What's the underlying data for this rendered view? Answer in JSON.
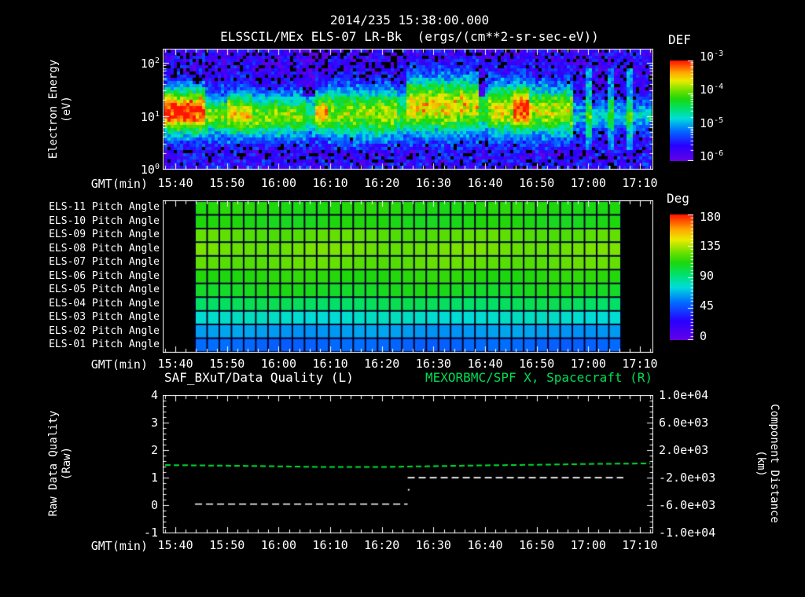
{
  "title": {
    "line1": "2014/235 15:38:00.000",
    "line2": "ELSSCIL/MEx ELS-07 LR-Bk  (ergs/(cm**2-sr-sec-eV))"
  },
  "time_axis": {
    "label": "GMT(min)",
    "start": "15:38",
    "ticks": [
      "15:40",
      "15:50",
      "16:00",
      "16:10",
      "16:20",
      "16:30",
      "16:40",
      "16:50",
      "17:00",
      "17:10"
    ]
  },
  "energy_panel": {
    "ylabel_line1": "Electron Energy",
    "ylabel_line2": "(eV)",
    "ytick_exponents": [
      "2",
      "1",
      "0"
    ],
    "colorbar": {
      "title": "DEF",
      "tick_exponents": [
        "-3",
        "-4",
        "-5",
        "-6"
      ]
    }
  },
  "pitch_panel": {
    "row_labels": [
      "ELS-11 Pitch Angle",
      "ELS-10 Pitch Angle",
      "ELS-09 Pitch Angle",
      "ELS-08 Pitch Angle",
      "ELS-07 Pitch Angle",
      "ELS-06 Pitch Angle",
      "ELS-05 Pitch Angle",
      "ELS-04 Pitch Angle",
      "ELS-03 Pitch Angle",
      "ELS-02 Pitch Angle",
      "ELS-01 Pitch Angle"
    ],
    "colorbar": {
      "title": "Deg",
      "ticks": [
        "180",
        "135",
        "90",
        "45",
        "0"
      ]
    }
  },
  "line_panel": {
    "title_left": "SAF_BXuT/Data Quality (L)",
    "title_right": "MEXORBMC/SPF X, Spacecraft (R)",
    "ylabel_left_line1": "Raw Data Quality",
    "ylabel_left_line2": "(Raw)",
    "ylabel_right_line1": "Component Distance",
    "ylabel_right_line2": "(km)",
    "yticks_left": [
      "4",
      "3",
      "2",
      "1",
      "0",
      "-1"
    ],
    "yticks_right": [
      "1.0e+04",
      "6.0e+03",
      "2.0e+03",
      "-2.0e+03",
      "-6.0e+03",
      "-1.0e+04"
    ]
  },
  "colors": {
    "background": "#000000",
    "text": "#ffffff",
    "title_green": "#00dd55",
    "line_green": "#00e030",
    "line_white": "#ffffff",
    "grid_dark": "#000022"
  },
  "chart_data": [
    {
      "type": "heatmap",
      "name": "electron_energy_flux_spectrogram",
      "x_label": "GMT(min)",
      "x_ticks": [
        "15:40",
        "15:50",
        "16:00",
        "16:10",
        "16:20",
        "16:30",
        "16:40",
        "16:50",
        "17:00",
        "17:10"
      ],
      "time_start": "15:38",
      "time_end": "17:12",
      "y_label": "Electron Energy (eV)",
      "y_scale": "log",
      "y_ticks_eV": [
        1,
        10,
        100
      ],
      "value_label": "DEF (ergs/(cm**2-sr-sec-eV))",
      "value_ticks": [
        0.001,
        0.0001,
        1e-05,
        1e-06
      ],
      "features": {
        "description": "Noisy rainbow spectrogram: main green/yellow flux band near 5-40 eV all interval; bright yellow/red enhancement 15:38-15:46; yellow blob ~16:07; broad bright band 16:25-16:57 with intense yellow column ~16:45-16:48; band ends ~16:58, after which only faint blue/cyan vertical streaks; blue/purple noise with black dropouts at lowest and highest energies",
        "segments": [
          {
            "t0_min": 0,
            "t1_min": 8,
            "intensity": 0.92,
            "center_log10_eV": 1.08,
            "width_log10": 0.42
          },
          {
            "t0_min": 8,
            "t1_min": 12,
            "intensity": 0.6,
            "center_log10_eV": 1.0,
            "width_log10": 0.38
          },
          {
            "t0_min": 12,
            "t1_min": 17,
            "intensity": 0.72,
            "center_log10_eV": 1.02,
            "width_log10": 0.4
          },
          {
            "t0_min": 17,
            "t1_min": 27,
            "intensity": 0.6,
            "center_log10_eV": 1.0,
            "width_log10": 0.4
          },
          {
            "t0_min": 27,
            "t1_min": 29,
            "intensity": 0.46,
            "center_log10_eV": 1.0,
            "width_log10": 0.36
          },
          {
            "t0_min": 29,
            "t1_min": 31.5,
            "intensity": 0.78,
            "center_log10_eV": 1.05,
            "width_log10": 0.38
          },
          {
            "t0_min": 31.5,
            "t1_min": 45,
            "intensity": 0.62,
            "center_log10_eV": 1.05,
            "width_log10": 0.46
          },
          {
            "t0_min": 45,
            "t1_min": 47,
            "intensity": 0.52,
            "center_log10_eV": 1.02,
            "width_log10": 0.42
          },
          {
            "t0_min": 47,
            "t1_min": 61,
            "intensity": 0.72,
            "center_log10_eV": 1.18,
            "width_log10": 0.52
          },
          {
            "t0_min": 61,
            "t1_min": 62.5,
            "intensity": 0.5,
            "center_log10_eV": 1.1,
            "width_log10": 0.45
          },
          {
            "t0_min": 62.5,
            "t1_min": 67.5,
            "intensity": 0.68,
            "center_log10_eV": 1.12,
            "width_log10": 0.48
          },
          {
            "t0_min": 67.5,
            "t1_min": 70.5,
            "intensity": 0.9,
            "center_log10_eV": 1.12,
            "width_log10": 0.46
          },
          {
            "t0_min": 70.5,
            "t1_min": 79,
            "intensity": 0.66,
            "center_log10_eV": 1.08,
            "width_log10": 0.46
          },
          {
            "t0_min": 79,
            "t1_min": 95,
            "intensity": 0.3,
            "center_log10_eV": 1.0,
            "width_log10": 0.3
          }
        ],
        "cyan_streaks_min": [
          82,
          86.5,
          90
        ],
        "dark_notches_min": [
          [
            26.5,
            29
          ],
          [
            60.7,
            62.3
          ]
        ]
      }
    },
    {
      "type": "heatmap",
      "name": "pitch_angle_by_anode",
      "x_label": "GMT(min)",
      "data_time_start": "15:43",
      "data_time_end": "17:05",
      "value_label": "Deg",
      "value_range": [
        0,
        180
      ],
      "columns": 35,
      "rows": [
        {
          "label": "ELS-11 Pitch Angle",
          "pitch_deg": 112
        },
        {
          "label": "ELS-10 Pitch Angle",
          "pitch_deg": 110
        },
        {
          "label": "ELS-09 Pitch Angle",
          "pitch_deg": 122
        },
        {
          "label": "ELS-08 Pitch Angle",
          "pitch_deg": 126
        },
        {
          "label": "ELS-07 Pitch Angle",
          "pitch_deg": 123
        },
        {
          "label": "ELS-06 Pitch Angle",
          "pitch_deg": 113
        },
        {
          "label": "ELS-05 Pitch Angle",
          "pitch_deg": 108
        },
        {
          "label": "ELS-04 Pitch Angle",
          "pitch_deg": 97
        },
        {
          "label": "ELS-03 Pitch Angle",
          "pitch_deg": 79
        },
        {
          "label": "ELS-02 Pitch Angle",
          "pitch_deg": 63
        },
        {
          "label": "ELS-01 Pitch Angle",
          "pitch_deg": 52
        }
      ]
    },
    {
      "type": "line",
      "name": "data_quality_and_spacecraft_x",
      "x_unit": "minutes_after_15:38",
      "ylim_left": [
        -1,
        4
      ],
      "ylim_right_km": [
        -10000,
        10000
      ],
      "right_axis_note": "right_km = left_value*4000 - 6000",
      "series": [
        {
          "name": "MEXORBMC/SPF X, Spacecraft (R)",
          "color_key": "line_green",
          "style": "dashed",
          "points": [
            [
              0,
              1.47
            ],
            [
              10,
              1.45
            ],
            [
              20,
              1.43
            ],
            [
              30,
              1.4
            ],
            [
              42,
              1.4
            ],
            [
              52,
              1.43
            ],
            [
              62,
              1.46
            ],
            [
              72,
              1.48
            ],
            [
              82,
              1.51
            ],
            [
              94,
              1.53
            ]
          ]
        },
        {
          "name": "SAF_BXuT/Data Quality (L)",
          "color_key": "line_white",
          "style": "dashed",
          "segments": [
            {
              "t0": 5.8,
              "t1": 47.0,
              "y": 0.05
            },
            {
              "t0": 47.0,
              "t1": 88.8,
              "y": 1.01
            }
          ],
          "gap_point": {
            "t": 47.2,
            "y": 0.57
          }
        }
      ]
    }
  ]
}
